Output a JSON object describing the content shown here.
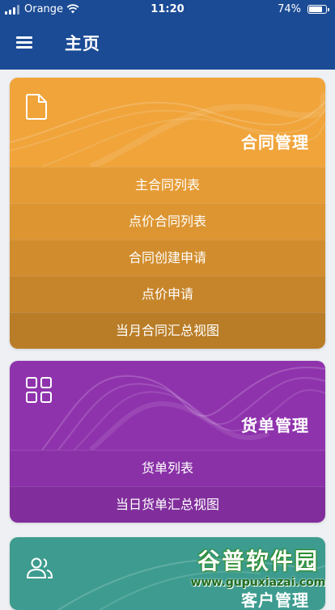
{
  "status_bar": {
    "carrier": "Orange",
    "time": "11:20",
    "battery": "74%"
  },
  "app_bar": {
    "title": "主页"
  },
  "cards": [
    {
      "title": "合同管理",
      "icon": "document-icon",
      "color": "#f0a43a",
      "items": [
        "主合同列表",
        "点价合同列表",
        "合同创建申请",
        "点价申请",
        "当月合同汇总视图"
      ]
    },
    {
      "title": "货单管理",
      "icon": "grid-icon",
      "color": "#8f33ad",
      "items": [
        "货单列表",
        "当日货单汇总视图"
      ]
    },
    {
      "title": "客户管理",
      "icon": "users-icon",
      "color": "#3d9c8f",
      "items": []
    }
  ],
  "watermark": {
    "main": "谷普软件园",
    "url": "www.gupuxiazai.com"
  }
}
